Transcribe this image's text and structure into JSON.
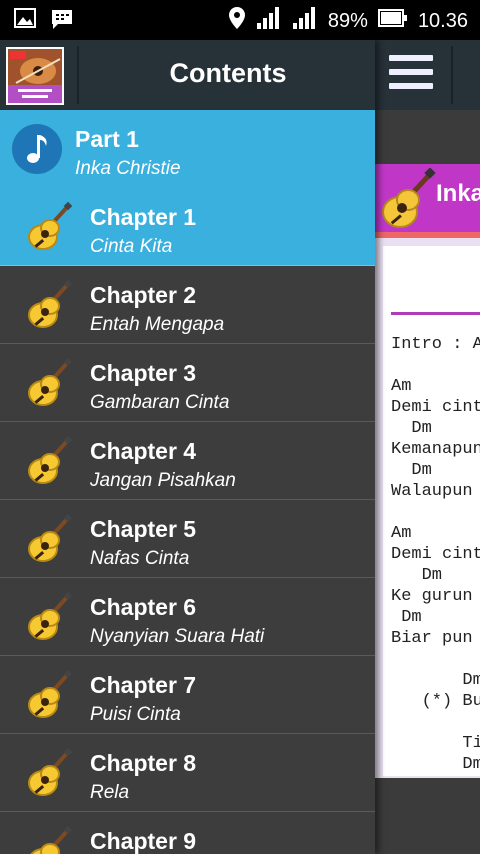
{
  "status_bar": {
    "battery": "89%",
    "time": "10.36"
  },
  "drawer": {
    "title": "Contents",
    "part": {
      "title": "Part 1",
      "subtitle": "Inka Christie"
    },
    "chapters": [
      {
        "title": "Chapter 1",
        "subtitle": "Cinta Kita"
      },
      {
        "title": "Chapter 2",
        "subtitle": "Entah Mengapa"
      },
      {
        "title": "Chapter 3",
        "subtitle": "Gambaran Cinta"
      },
      {
        "title": "Chapter 4",
        "subtitle": "Jangan Pisahkan"
      },
      {
        "title": "Chapter 5",
        "subtitle": "Nafas Cinta"
      },
      {
        "title": "Chapter 6",
        "subtitle": "Nyanyian Suara Hati"
      },
      {
        "title": "Chapter 7",
        "subtitle": "Puisi Cinta"
      },
      {
        "title": "Chapter 8",
        "subtitle": "Rela"
      },
      {
        "title": "Chapter 9",
        "subtitle": ""
      }
    ]
  },
  "content": {
    "card_title": "Inka",
    "lyrics": "Intro : A\n\nAm\nDemi cint\n  Dm\nKemanapun\n  Dm\nWalaupun\n\nAm\nDemi cint\n   Dm\nKe gurun\n Dm\nBiar pun\n\n       Dm\n   (*) Bu\n\n       Ti\n       Dm"
  },
  "colors": {
    "accent": "#39b0de",
    "toolbar": "#263238",
    "card_header": "#c037c8"
  }
}
